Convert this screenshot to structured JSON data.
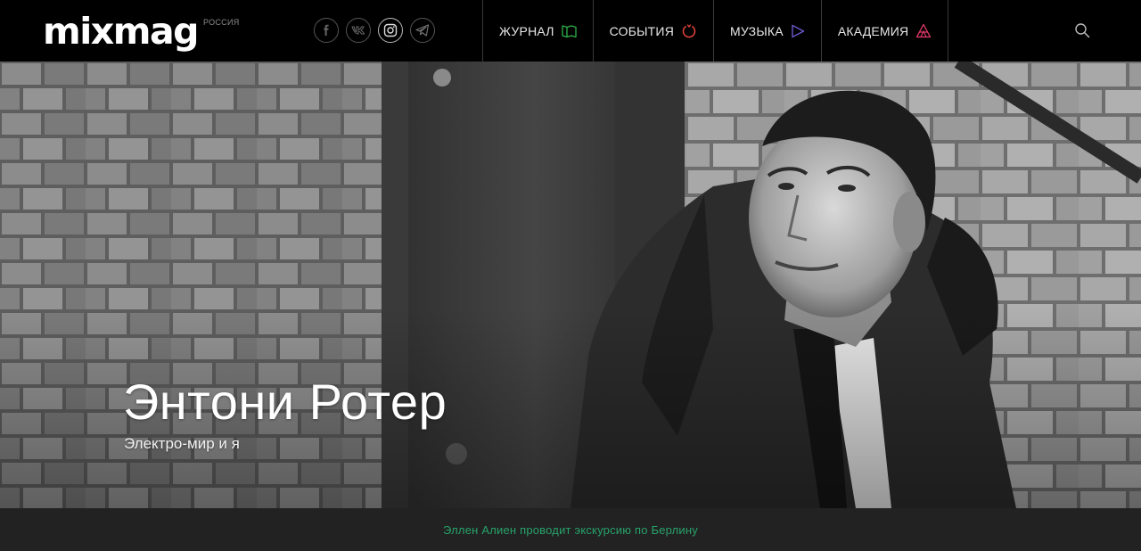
{
  "header": {
    "logo": "mixmag",
    "region": "РОССИЯ",
    "socials": [
      {
        "icon": "facebook-icon"
      },
      {
        "icon": "vk-icon"
      },
      {
        "icon": "instagram-icon"
      },
      {
        "icon": "telegram-icon"
      }
    ],
    "nav": [
      {
        "label": "ЖУРНАЛ",
        "icon": "journal-icon",
        "color": "#2fb24a"
      },
      {
        "label": "СОБЫТИЯ",
        "icon": "power-icon",
        "color": "#e8433a"
      },
      {
        "label": "МУЗЫКА",
        "icon": "play-icon",
        "color": "#6a5acd"
      },
      {
        "label": "АКАДЕМИЯ",
        "icon": "academy-icon",
        "color": "#e23a6a"
      }
    ],
    "search_icon": "search-icon"
  },
  "hero": {
    "title": "Энтони Ротер",
    "subtitle": "Электро-мир и я"
  },
  "ticker": {
    "text": "Эллен Алиен проводит экскурсию по Берлину",
    "color": "#27a36a"
  }
}
